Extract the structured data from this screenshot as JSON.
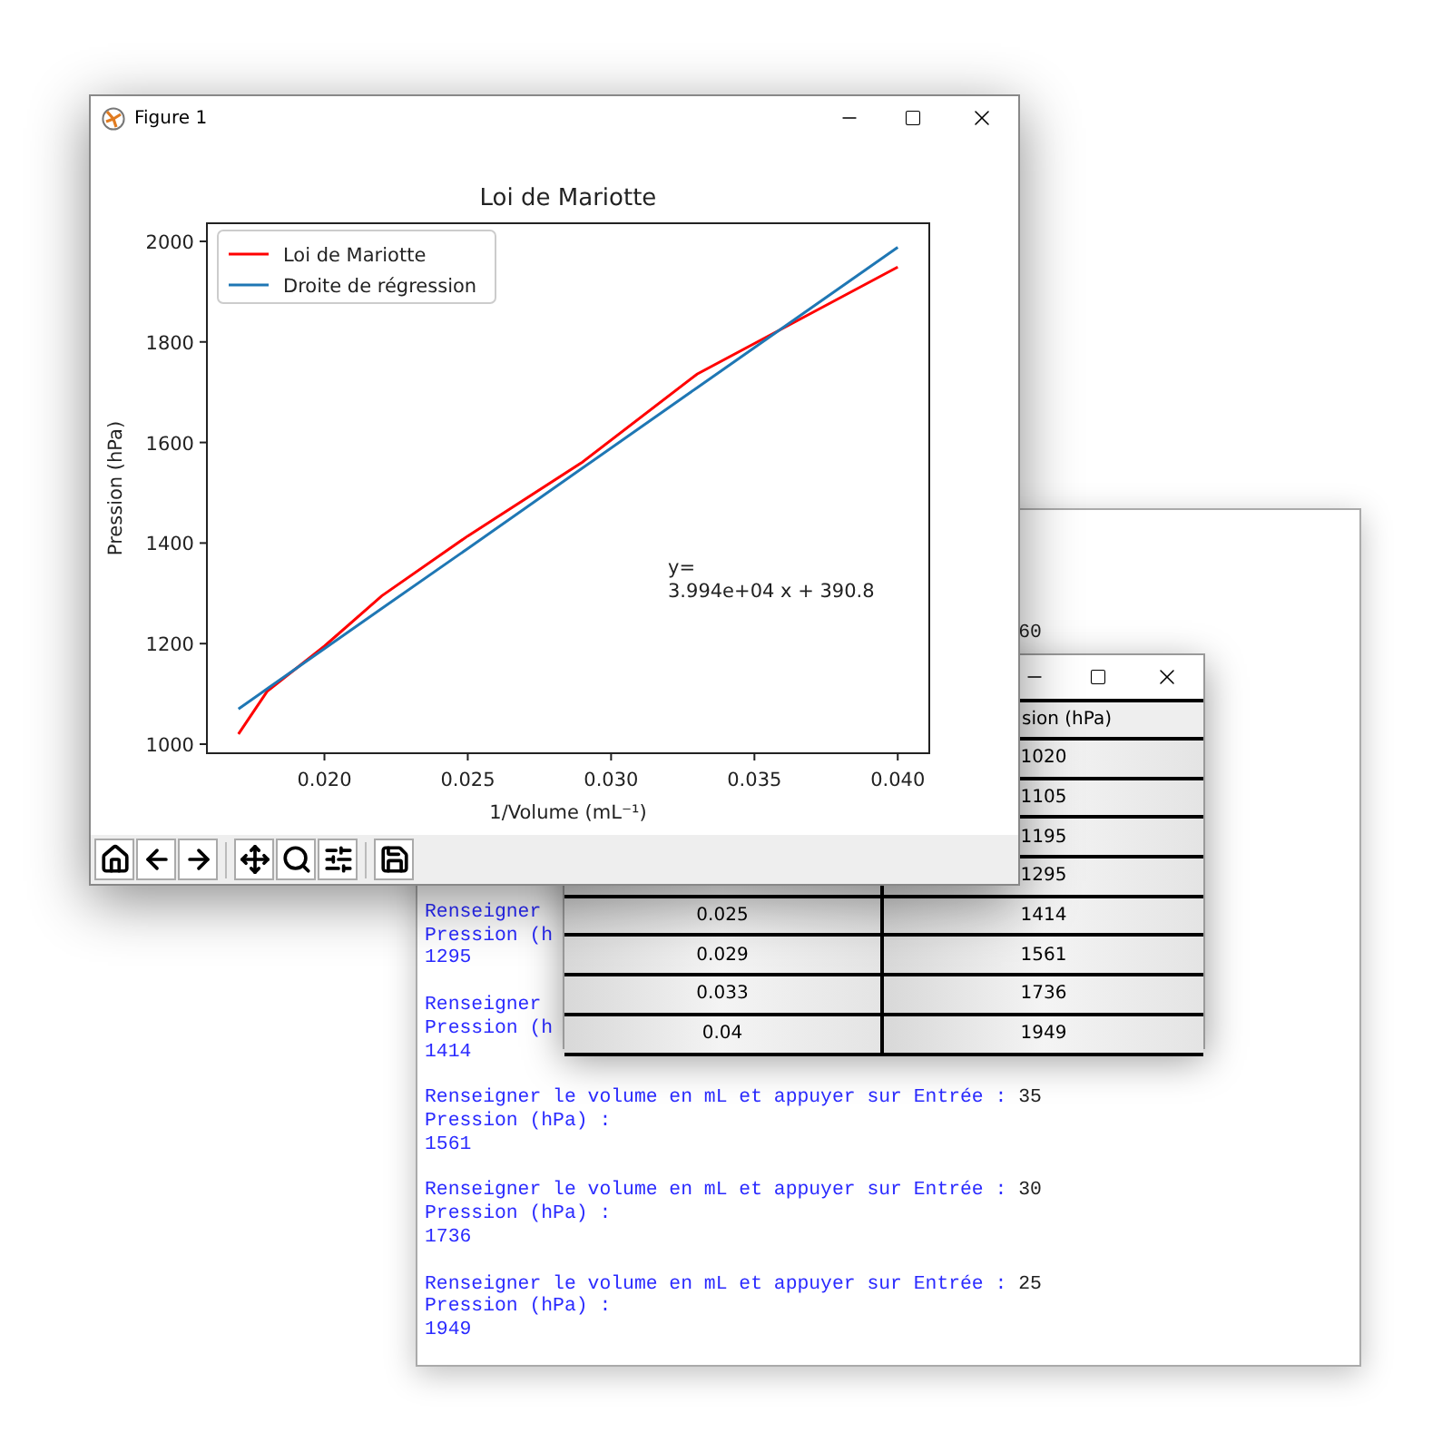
{
  "figure_window": {
    "title": "Figure 1",
    "chart_data": {
      "type": "line",
      "title": "Loi de Mariotte",
      "xlabel": "1/Volume (mL⁻¹)",
      "ylabel": "Pression (hPa)",
      "x": [
        0.017,
        0.018,
        0.02,
        0.022,
        0.025,
        0.029,
        0.033,
        0.04
      ],
      "series": [
        {
          "name": "Loi de Mariotte",
          "color": "#ff0000",
          "values": [
            1020,
            1105,
            1195,
            1295,
            1414,
            1561,
            1736,
            1949
          ]
        },
        {
          "name": "Droite de régression",
          "color": "#1f77b4",
          "values": [
            1070,
            1110,
            1190,
            1270,
            1389,
            1549,
            1709,
            1988
          ]
        }
      ],
      "legend": true,
      "xlim": [
        0.0159,
        0.0411
      ],
      "ylim": [
        982,
        2036
      ],
      "xticks": [
        {
          "value": 0.02,
          "label": "0.020"
        },
        {
          "value": 0.025,
          "label": "0.025"
        },
        {
          "value": 0.03,
          "label": "0.030"
        },
        {
          "value": 0.035,
          "label": "0.035"
        },
        {
          "value": 0.04,
          "label": "0.040"
        }
      ],
      "yticks": [
        1000,
        1200,
        1400,
        1600,
        1800,
        2000
      ],
      "annotations": [
        {
          "text": "y=\n3.994e+04 x + 390.8"
        }
      ]
    },
    "toolbar": [
      {
        "kind": "home"
      },
      {
        "kind": "back"
      },
      {
        "kind": "forward"
      },
      {
        "kind": "separator"
      },
      {
        "kind": "pan"
      },
      {
        "kind": "zoom"
      },
      {
        "kind": "configure"
      },
      {
        "kind": "separator"
      },
      {
        "kind": "save"
      }
    ]
  },
  "table_window": {
    "header": {
      "column_2": "sion (hPa)"
    },
    "rows": [
      {
        "column_2": "1020"
      },
      {
        "column_2": "1105"
      },
      {
        "column_2": "1195"
      },
      {
        "column_2": "1295"
      },
      {
        "column_1": "0.025",
        "column_2": "1414"
      },
      {
        "column_1": "0.029",
        "column_2": "1561"
      },
      {
        "column_1": "0.033",
        "column_2": "1736"
      },
      {
        "column_1": "0.04",
        "column_2": "1949"
      }
    ]
  },
  "console": {
    "lines": [
      {
        "kind": "tail",
        "input": "60"
      },
      {
        "kind": "gap"
      },
      {
        "kind": "text",
        "text": "Renseigner"
      },
      {
        "kind": "text",
        "text": "Pression (h"
      },
      {
        "kind": "text",
        "text": "1295"
      },
      {
        "kind": "blank"
      },
      {
        "kind": "text",
        "text": "Renseigner"
      },
      {
        "kind": "text",
        "text": "Pression (h"
      },
      {
        "kind": "text",
        "text": "1414"
      },
      {
        "kind": "blank"
      },
      {
        "kind": "prompt",
        "text": "Renseigner le volume en mL et appuyer sur Entrée : ",
        "input": "35"
      },
      {
        "kind": "text",
        "text": "Pression (hPa) :"
      },
      {
        "kind": "text",
        "text": "1561"
      },
      {
        "kind": "blank"
      },
      {
        "kind": "prompt",
        "text": "Renseigner le volume en mL et appuyer sur Entrée : ",
        "input": "30"
      },
      {
        "kind": "text",
        "text": "Pression (hPa) :"
      },
      {
        "kind": "text",
        "text": "1736"
      },
      {
        "kind": "blank"
      },
      {
        "kind": "prompt",
        "text": "Renseigner le volume en mL et appuyer sur Entrée : ",
        "input": "25"
      },
      {
        "kind": "text",
        "text": "Pression (hPa) :"
      },
      {
        "kind": "text",
        "text": "1949"
      }
    ]
  }
}
